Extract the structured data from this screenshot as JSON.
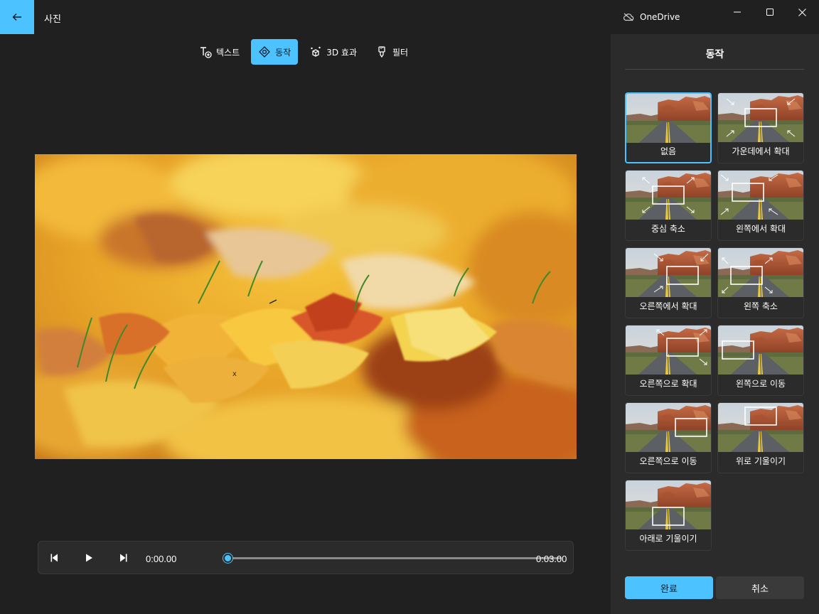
{
  "window": {
    "title": "사진",
    "onedrive_label": "OneDrive"
  },
  "toolbar": {
    "items": [
      {
        "label": "텍스트",
        "icon": "text-add-icon"
      },
      {
        "label": "동작",
        "icon": "motion-icon",
        "active": true
      },
      {
        "label": "3D 효과",
        "icon": "effects-3d-icon"
      },
      {
        "label": "필터",
        "icon": "filter-brush-icon"
      }
    ]
  },
  "player": {
    "current_time": "0:00.00",
    "total_time": "0:03.00",
    "progress_fraction": 0.0
  },
  "panel": {
    "title": "동작",
    "motions": [
      {
        "label": "없음",
        "selected": true
      },
      {
        "label": "가운데에서 확대"
      },
      {
        "label": "중심 축소"
      },
      {
        "label": "왼쪽에서 확대"
      },
      {
        "label": "오른쪽에서 확대"
      },
      {
        "label": "왼쪽 축소"
      },
      {
        "label": "오른쪽으로 확대"
      },
      {
        "label": "왼쪽으로 이동"
      },
      {
        "label": "오른쪽으로 이동"
      },
      {
        "label": "위로 기울이기"
      },
      {
        "label": "아래로 기울이기"
      }
    ],
    "done_label": "완료",
    "cancel_label": "취소"
  },
  "colors": {
    "accent": "#4cc2ff",
    "background": "#202020",
    "panel": "#2b2b2b"
  }
}
